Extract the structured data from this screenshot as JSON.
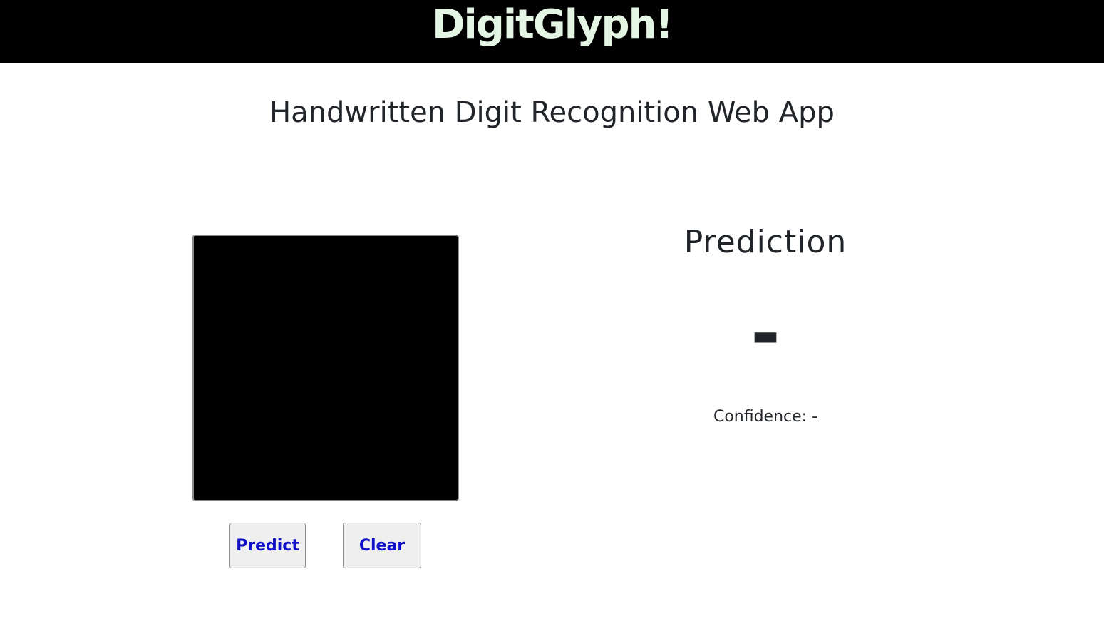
{
  "header": {
    "brand": "DigitGlyph!"
  },
  "main": {
    "subtitle": "Handwritten Digit Recognition Web App"
  },
  "canvas": {
    "background": "#000000"
  },
  "actions": {
    "predict_label": "Predict",
    "clear_label": "Clear"
  },
  "result": {
    "title": "Prediction",
    "value": "-",
    "confidence_label": "Confidence: -"
  }
}
